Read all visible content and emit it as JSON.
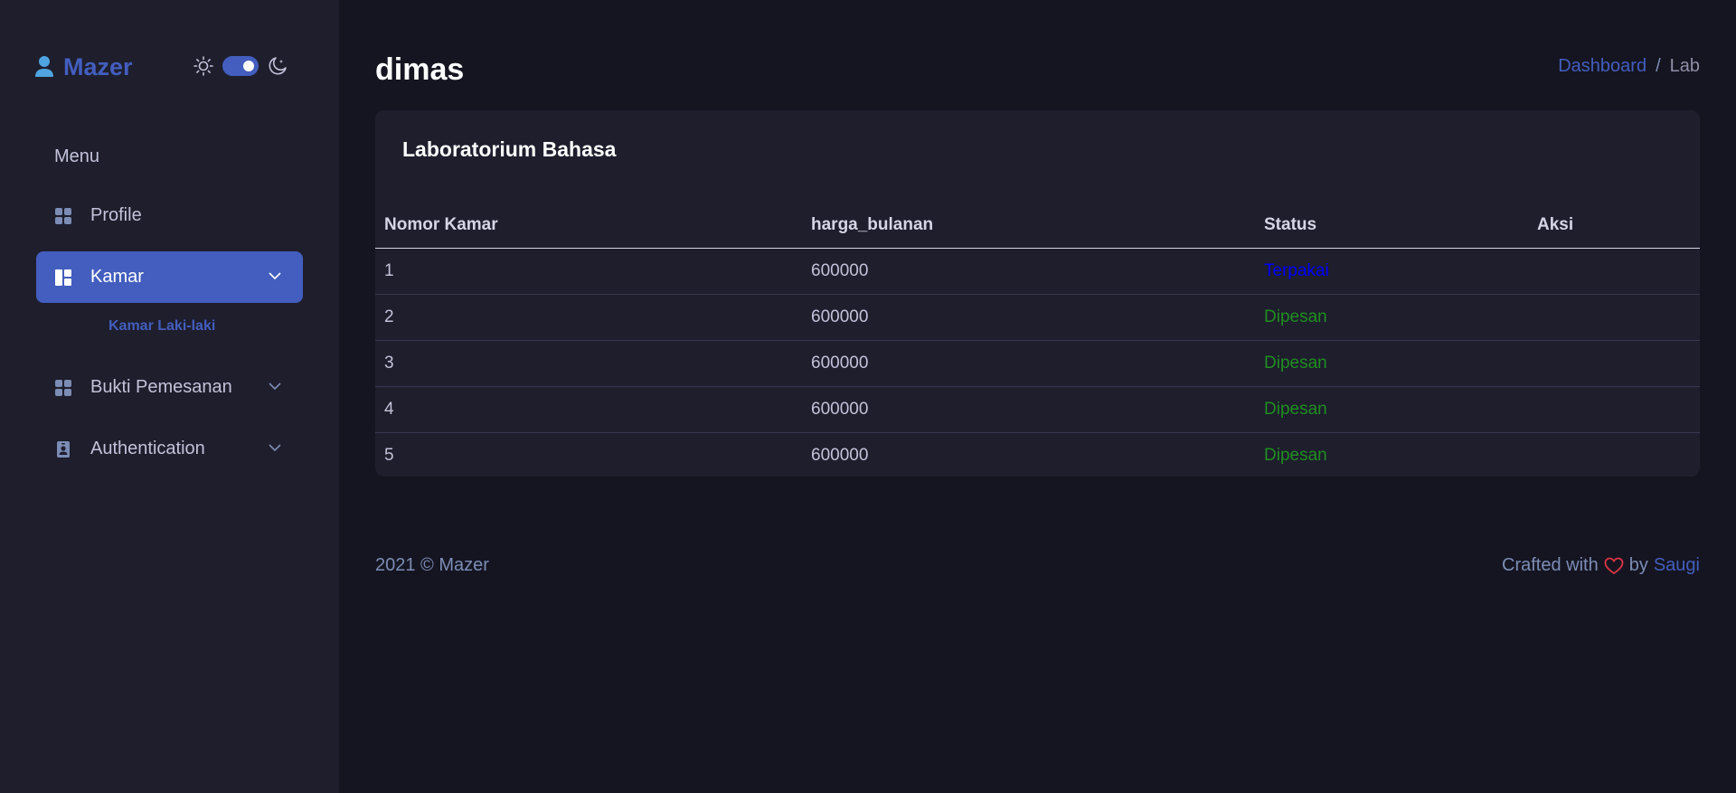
{
  "brand": {
    "name": "Mazer",
    "icon": "user-icon"
  },
  "theme": {
    "light_icon": "sun-icon",
    "dark_icon": "moon-icon",
    "dark_mode": true
  },
  "sidebar": {
    "menu_title": "Menu",
    "items": [
      {
        "label": "Profile",
        "icon": "grid-icon",
        "has_submenu": false
      },
      {
        "label": "Kamar",
        "icon": "layout-icon",
        "has_submenu": true,
        "active": true
      },
      {
        "label": "Bukti Pemesanan",
        "icon": "grid-icon",
        "has_submenu": true
      },
      {
        "label": "Authentication",
        "icon": "person-badge-icon",
        "has_submenu": true
      }
    ],
    "submenu": {
      "label": "Kamar Laki-laki"
    }
  },
  "header": {
    "title": "dimas",
    "breadcrumb": {
      "link": "Dashboard",
      "separator": "/",
      "current": "Lab"
    }
  },
  "card": {
    "title": "Laboratorium Bahasa",
    "columns": [
      "Nomor Kamar",
      "harga_bulanan",
      "Status",
      "Aksi"
    ],
    "rows": [
      {
        "nomor": "1",
        "harga": "600000",
        "status": "Terpakai"
      },
      {
        "nomor": "2",
        "harga": "600000",
        "status": "Dipesan"
      },
      {
        "nomor": "3",
        "harga": "600000",
        "status": "Dipesan"
      },
      {
        "nomor": "4",
        "harga": "600000",
        "status": "Dipesan"
      },
      {
        "nomor": "5",
        "harga": "600000",
        "status": "Dipesan"
      }
    ]
  },
  "footer": {
    "left": "2021 © Mazer",
    "crafted": "Crafted with",
    "by": "by",
    "author": "Saugi"
  },
  "colors": {
    "accent": "#435ebe",
    "status_terpakai": "#0000ff",
    "status_dipesan": "#1f8f1f",
    "heart": "#dc3545"
  }
}
